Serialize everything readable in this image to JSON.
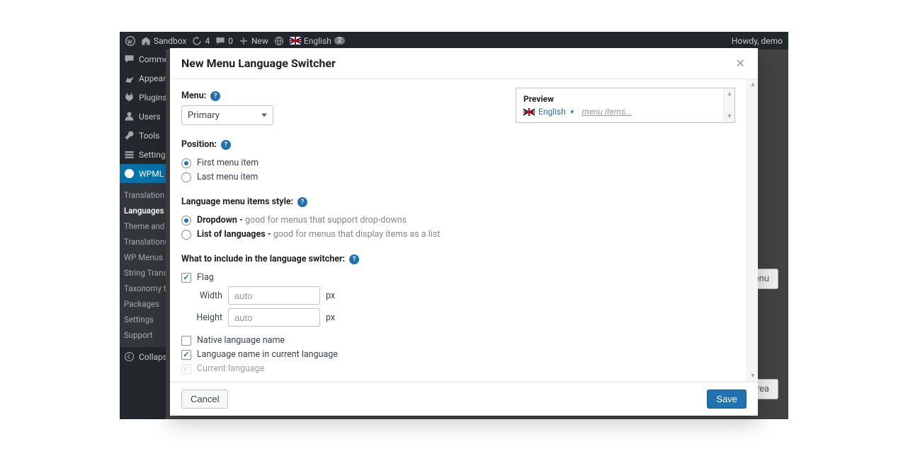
{
  "admin_bar": {
    "site_name": "Sandbox",
    "updates_count": "4",
    "comments_count": "0",
    "new_label": "New",
    "lang_label": "English",
    "howdy": "Howdy, demo"
  },
  "sidebar": {
    "items": [
      {
        "label": "Comme"
      },
      {
        "label": "Appear"
      },
      {
        "label": "Plugins"
      },
      {
        "label": "Users"
      },
      {
        "label": "Tools"
      },
      {
        "label": "Setting"
      }
    ],
    "active": "WPML",
    "sub": [
      {
        "label": "Translation Management"
      },
      {
        "label": "Languages",
        "current": true
      },
      {
        "label": "Theme and localization"
      },
      {
        "label": "Translations"
      },
      {
        "label": "WP Menus"
      },
      {
        "label": "String Trans"
      },
      {
        "label": "Taxonomy t"
      },
      {
        "label": "Packages"
      },
      {
        "label": "Settings"
      },
      {
        "label": "Support"
      }
    ],
    "collapse": "Collaps"
  },
  "dim_btns": {
    "menu": "enu",
    "area": "rea"
  },
  "modal": {
    "title": "New Menu Language Switcher",
    "menu_label": "Menu:",
    "menu_value": "Primary",
    "position_label": "Position:",
    "pos_first": "First menu item",
    "pos_last": "Last menu item",
    "style_label": "Language menu items style:",
    "style_dropdown_strong": "Dropdown - ",
    "style_dropdown_desc": "good for menus that support drop-downs",
    "style_list_strong": "List of languages - ",
    "style_list_desc": "good for menus that display items as a list",
    "include_label": "What to include in the language switcher:",
    "flag_label": "Flag",
    "width_label": "Width",
    "height_label": "Height",
    "auto_placeholder": "auto",
    "px_unit": "px",
    "native_label": "Native language name",
    "current_lang_name_label": "Language name in current language",
    "current_lang_label": "Current language",
    "preview_title": "Preview",
    "preview_lang": "English",
    "preview_menu_items": "menu items...",
    "cancel": "Cancel",
    "save": "Save"
  }
}
